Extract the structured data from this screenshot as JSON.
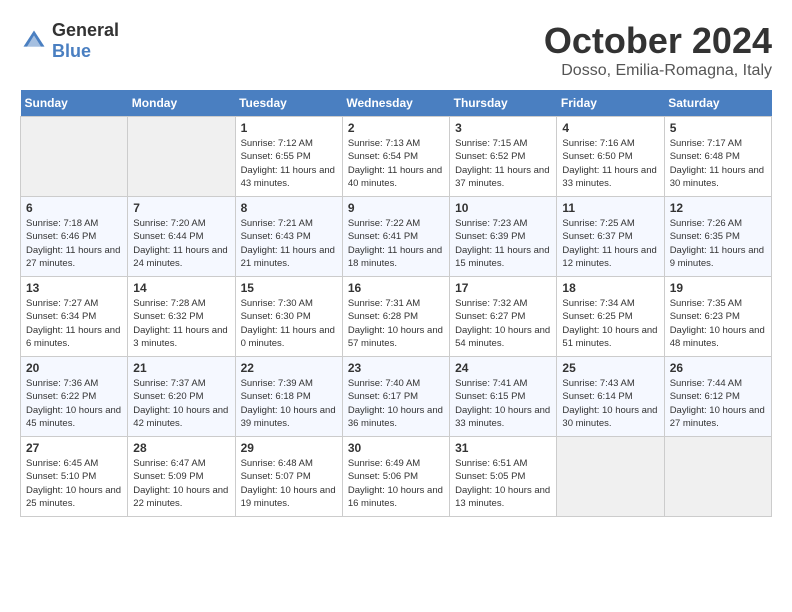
{
  "header": {
    "logo_general": "General",
    "logo_blue": "Blue",
    "month": "October 2024",
    "location": "Dosso, Emilia-Romagna, Italy"
  },
  "weekdays": [
    "Sunday",
    "Monday",
    "Tuesday",
    "Wednesday",
    "Thursday",
    "Friday",
    "Saturday"
  ],
  "weeks": [
    [
      {
        "day": "",
        "sunrise": "",
        "sunset": "",
        "daylight": ""
      },
      {
        "day": "",
        "sunrise": "",
        "sunset": "",
        "daylight": ""
      },
      {
        "day": "1",
        "sunrise": "Sunrise: 7:12 AM",
        "sunset": "Sunset: 6:55 PM",
        "daylight": "Daylight: 11 hours and 43 minutes."
      },
      {
        "day": "2",
        "sunrise": "Sunrise: 7:13 AM",
        "sunset": "Sunset: 6:54 PM",
        "daylight": "Daylight: 11 hours and 40 minutes."
      },
      {
        "day": "3",
        "sunrise": "Sunrise: 7:15 AM",
        "sunset": "Sunset: 6:52 PM",
        "daylight": "Daylight: 11 hours and 37 minutes."
      },
      {
        "day": "4",
        "sunrise": "Sunrise: 7:16 AM",
        "sunset": "Sunset: 6:50 PM",
        "daylight": "Daylight: 11 hours and 33 minutes."
      },
      {
        "day": "5",
        "sunrise": "Sunrise: 7:17 AM",
        "sunset": "Sunset: 6:48 PM",
        "daylight": "Daylight: 11 hours and 30 minutes."
      }
    ],
    [
      {
        "day": "6",
        "sunrise": "Sunrise: 7:18 AM",
        "sunset": "Sunset: 6:46 PM",
        "daylight": "Daylight: 11 hours and 27 minutes."
      },
      {
        "day": "7",
        "sunrise": "Sunrise: 7:20 AM",
        "sunset": "Sunset: 6:44 PM",
        "daylight": "Daylight: 11 hours and 24 minutes."
      },
      {
        "day": "8",
        "sunrise": "Sunrise: 7:21 AM",
        "sunset": "Sunset: 6:43 PM",
        "daylight": "Daylight: 11 hours and 21 minutes."
      },
      {
        "day": "9",
        "sunrise": "Sunrise: 7:22 AM",
        "sunset": "Sunset: 6:41 PM",
        "daylight": "Daylight: 11 hours and 18 minutes."
      },
      {
        "day": "10",
        "sunrise": "Sunrise: 7:23 AM",
        "sunset": "Sunset: 6:39 PM",
        "daylight": "Daylight: 11 hours and 15 minutes."
      },
      {
        "day": "11",
        "sunrise": "Sunrise: 7:25 AM",
        "sunset": "Sunset: 6:37 PM",
        "daylight": "Daylight: 11 hours and 12 minutes."
      },
      {
        "day": "12",
        "sunrise": "Sunrise: 7:26 AM",
        "sunset": "Sunset: 6:35 PM",
        "daylight": "Daylight: 11 hours and 9 minutes."
      }
    ],
    [
      {
        "day": "13",
        "sunrise": "Sunrise: 7:27 AM",
        "sunset": "Sunset: 6:34 PM",
        "daylight": "Daylight: 11 hours and 6 minutes."
      },
      {
        "day": "14",
        "sunrise": "Sunrise: 7:28 AM",
        "sunset": "Sunset: 6:32 PM",
        "daylight": "Daylight: 11 hours and 3 minutes."
      },
      {
        "day": "15",
        "sunrise": "Sunrise: 7:30 AM",
        "sunset": "Sunset: 6:30 PM",
        "daylight": "Daylight: 11 hours and 0 minutes."
      },
      {
        "day": "16",
        "sunrise": "Sunrise: 7:31 AM",
        "sunset": "Sunset: 6:28 PM",
        "daylight": "Daylight: 10 hours and 57 minutes."
      },
      {
        "day": "17",
        "sunrise": "Sunrise: 7:32 AM",
        "sunset": "Sunset: 6:27 PM",
        "daylight": "Daylight: 10 hours and 54 minutes."
      },
      {
        "day": "18",
        "sunrise": "Sunrise: 7:34 AM",
        "sunset": "Sunset: 6:25 PM",
        "daylight": "Daylight: 10 hours and 51 minutes."
      },
      {
        "day": "19",
        "sunrise": "Sunrise: 7:35 AM",
        "sunset": "Sunset: 6:23 PM",
        "daylight": "Daylight: 10 hours and 48 minutes."
      }
    ],
    [
      {
        "day": "20",
        "sunrise": "Sunrise: 7:36 AM",
        "sunset": "Sunset: 6:22 PM",
        "daylight": "Daylight: 10 hours and 45 minutes."
      },
      {
        "day": "21",
        "sunrise": "Sunrise: 7:37 AM",
        "sunset": "Sunset: 6:20 PM",
        "daylight": "Daylight: 10 hours and 42 minutes."
      },
      {
        "day": "22",
        "sunrise": "Sunrise: 7:39 AM",
        "sunset": "Sunset: 6:18 PM",
        "daylight": "Daylight: 10 hours and 39 minutes."
      },
      {
        "day": "23",
        "sunrise": "Sunrise: 7:40 AM",
        "sunset": "Sunset: 6:17 PM",
        "daylight": "Daylight: 10 hours and 36 minutes."
      },
      {
        "day": "24",
        "sunrise": "Sunrise: 7:41 AM",
        "sunset": "Sunset: 6:15 PM",
        "daylight": "Daylight: 10 hours and 33 minutes."
      },
      {
        "day": "25",
        "sunrise": "Sunrise: 7:43 AM",
        "sunset": "Sunset: 6:14 PM",
        "daylight": "Daylight: 10 hours and 30 minutes."
      },
      {
        "day": "26",
        "sunrise": "Sunrise: 7:44 AM",
        "sunset": "Sunset: 6:12 PM",
        "daylight": "Daylight: 10 hours and 27 minutes."
      }
    ],
    [
      {
        "day": "27",
        "sunrise": "Sunrise: 6:45 AM",
        "sunset": "Sunset: 5:10 PM",
        "daylight": "Daylight: 10 hours and 25 minutes."
      },
      {
        "day": "28",
        "sunrise": "Sunrise: 6:47 AM",
        "sunset": "Sunset: 5:09 PM",
        "daylight": "Daylight: 10 hours and 22 minutes."
      },
      {
        "day": "29",
        "sunrise": "Sunrise: 6:48 AM",
        "sunset": "Sunset: 5:07 PM",
        "daylight": "Daylight: 10 hours and 19 minutes."
      },
      {
        "day": "30",
        "sunrise": "Sunrise: 6:49 AM",
        "sunset": "Sunset: 5:06 PM",
        "daylight": "Daylight: 10 hours and 16 minutes."
      },
      {
        "day": "31",
        "sunrise": "Sunrise: 6:51 AM",
        "sunset": "Sunset: 5:05 PM",
        "daylight": "Daylight: 10 hours and 13 minutes."
      },
      {
        "day": "",
        "sunrise": "",
        "sunset": "",
        "daylight": ""
      },
      {
        "day": "",
        "sunrise": "",
        "sunset": "",
        "daylight": ""
      }
    ]
  ]
}
